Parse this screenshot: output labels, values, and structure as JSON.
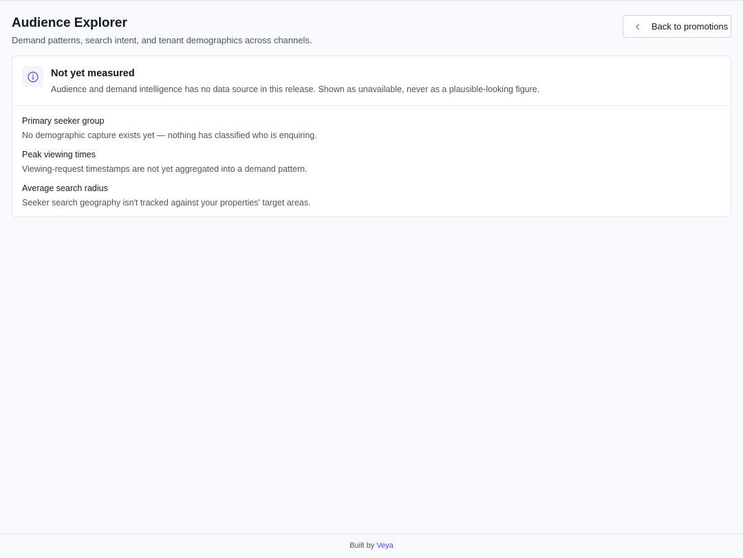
{
  "header": {
    "title": "Audience Explorer",
    "subtitle": "Demand patterns, search intent, and tenant demographics across channels.",
    "back_button_label": "Back to promotions"
  },
  "notice": {
    "icon": "info-icon",
    "title": "Not yet measured",
    "body": "Audience and demand intelligence has no data source in this release. Shown as unavailable, never as a plausible-looking figure."
  },
  "metrics": [
    {
      "label": "Primary seeker group",
      "description": "No demographic capture exists yet — nothing has classified who is enquiring."
    },
    {
      "label": "Peak viewing times",
      "description": "Viewing-request timestamps are not yet aggregated into a demand pattern."
    },
    {
      "label": "Average search radius",
      "description": "Seeker search geography isn't tracked against your properties' target areas."
    }
  ],
  "footer": {
    "prefix": "Built by",
    "brand": "Veya"
  },
  "colors": {
    "accent": "#4f46e5",
    "background": "#f8f9fb",
    "card": "#ffffff",
    "border": "#e5e7eb",
    "muted_text": "#4b5563"
  }
}
